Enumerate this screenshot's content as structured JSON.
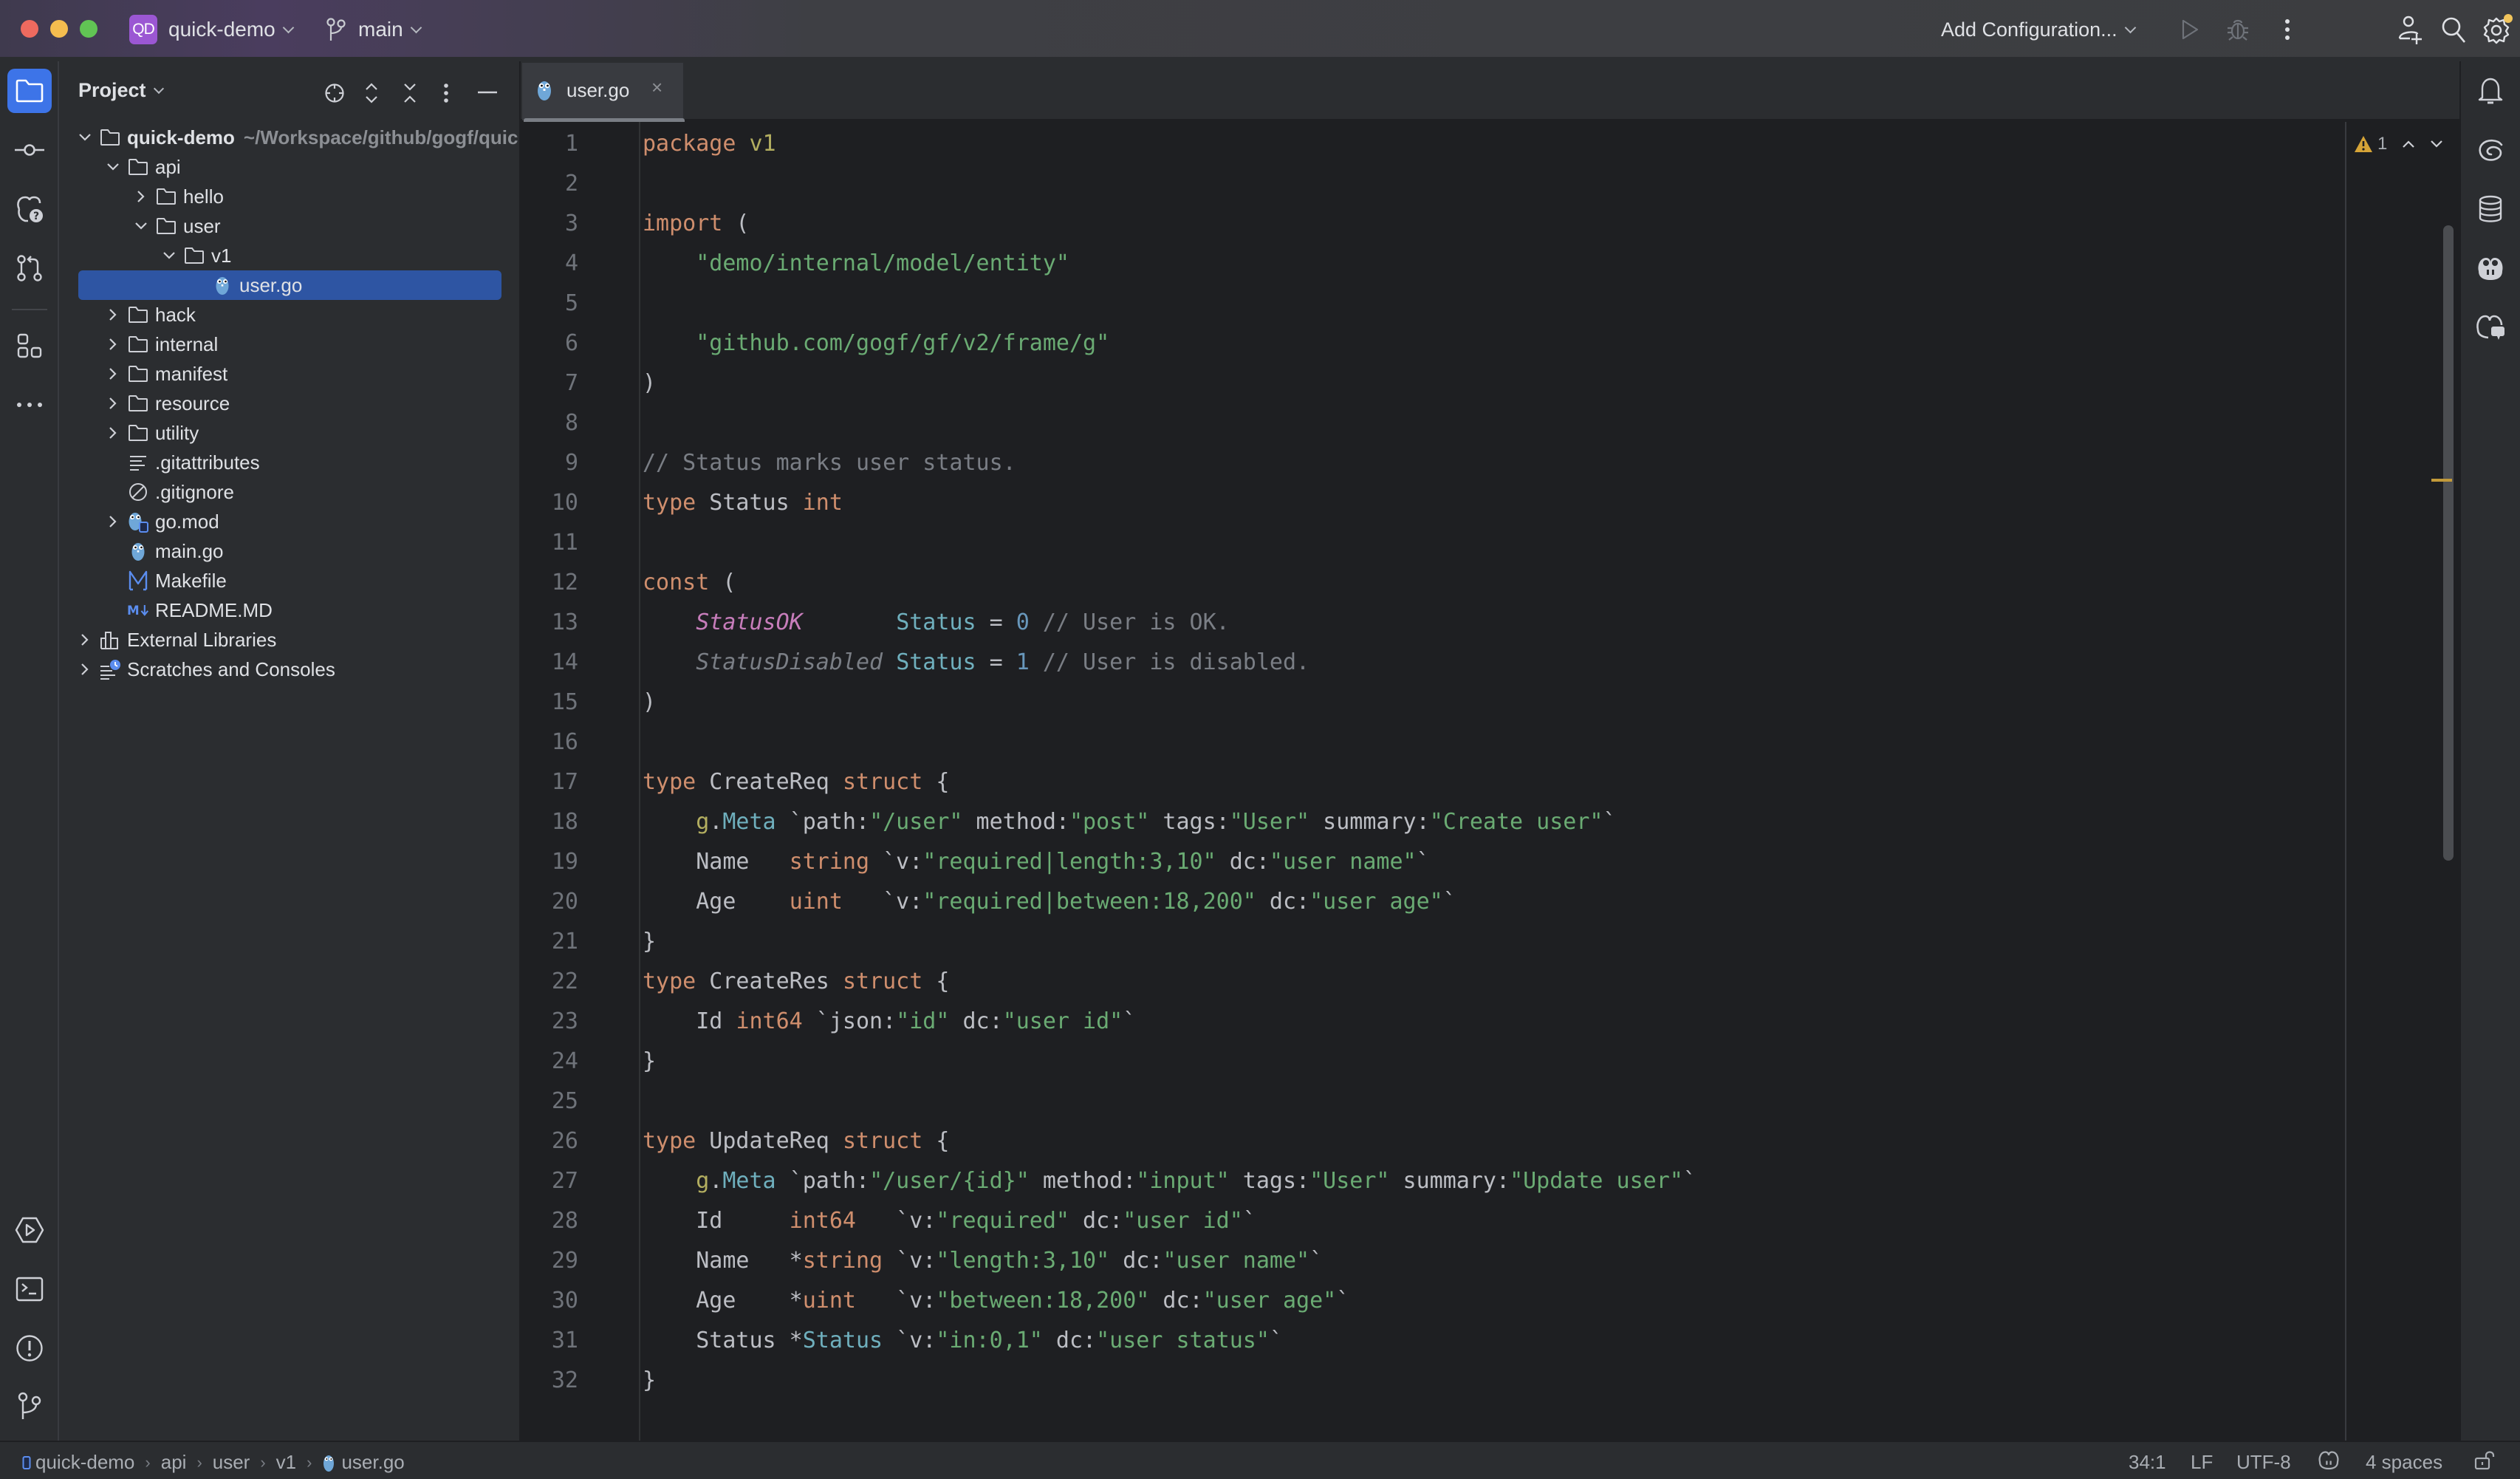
{
  "titlebar": {
    "project_badge": "QD",
    "project_name": "quick-demo",
    "branch": "main",
    "run_config": "Add Configuration...",
    "icons": [
      "run-icon",
      "debug-icon",
      "more-vertical-icon",
      "add-user-icon",
      "search-icon",
      "settings-icon"
    ]
  },
  "left_strip": {
    "top_tools": [
      "project",
      "commit",
      "copilot-help",
      "pull-requests",
      "structure",
      "more"
    ],
    "bottom_tools": [
      "services",
      "terminal",
      "problems",
      "git"
    ]
  },
  "project_panel": {
    "title": "Project",
    "tree": [
      {
        "label": "quick-demo",
        "path": "~/Workspace/github/gogf/quick-demo",
        "type": "folder",
        "depth": 0,
        "expanded": true,
        "bold": true
      },
      {
        "label": "api",
        "type": "folder",
        "depth": 1,
        "expanded": true
      },
      {
        "label": "hello",
        "type": "folder",
        "depth": 2,
        "expanded": false
      },
      {
        "label": "user",
        "type": "folder",
        "depth": 2,
        "expanded": true
      },
      {
        "label": "v1",
        "type": "folder",
        "depth": 3,
        "expanded": true
      },
      {
        "label": "user.go",
        "type": "go",
        "depth": 4,
        "selected": true
      },
      {
        "label": "hack",
        "type": "folder",
        "depth": 1,
        "expanded": false
      },
      {
        "label": "internal",
        "type": "folder",
        "depth": 1,
        "expanded": false
      },
      {
        "label": "manifest",
        "type": "folder",
        "depth": 1,
        "expanded": false
      },
      {
        "label": "resource",
        "type": "folder",
        "depth": 1,
        "expanded": false
      },
      {
        "label": "utility",
        "type": "folder",
        "depth": 1,
        "expanded": false
      },
      {
        "label": ".gitattributes",
        "type": "text",
        "depth": 1
      },
      {
        "label": ".gitignore",
        "type": "ignore",
        "depth": 1
      },
      {
        "label": "go.mod",
        "type": "gomod",
        "depth": 1,
        "expanded": false
      },
      {
        "label": "main.go",
        "type": "go",
        "depth": 1
      },
      {
        "label": "Makefile",
        "type": "makefile",
        "depth": 1
      },
      {
        "label": "README.MD",
        "type": "markdown",
        "depth": 1
      },
      {
        "label": "External Libraries",
        "type": "library",
        "depth": 0,
        "expanded": false
      },
      {
        "label": "Scratches and Consoles",
        "type": "scratches",
        "depth": 0,
        "expanded": false
      }
    ]
  },
  "editor": {
    "tab": {
      "label": "user.go",
      "close": "×"
    },
    "warnings": "1",
    "lines": [
      [
        [
          "k",
          "package"
        ],
        [
          "t",
          " "
        ],
        [
          "pk",
          "v1"
        ]
      ],
      [],
      [
        [
          "k",
          "import"
        ],
        [
          "t",
          " ("
        ]
      ],
      [
        [
          "t",
          "    "
        ],
        [
          "s",
          "\"demo/internal/model/entity\""
        ]
      ],
      [],
      [
        [
          "t",
          "    "
        ],
        [
          "s",
          "\"github.com/gogf/gf/v2/frame/g\""
        ]
      ],
      [
        [
          "t",
          ")"
        ]
      ],
      [],
      [
        [
          "c",
          "// Status marks user status."
        ]
      ],
      [
        [
          "k",
          "type"
        ],
        [
          "t",
          " Status "
        ],
        [
          "k",
          "int"
        ]
      ],
      [],
      [
        [
          "k",
          "const"
        ],
        [
          "t",
          " ("
        ]
      ],
      [
        [
          "t",
          "    "
        ],
        [
          "cv",
          "StatusOK"
        ],
        [
          "t",
          "       "
        ],
        [
          "ty",
          "Status"
        ],
        [
          "t",
          " = "
        ],
        [
          "n2",
          "0"
        ],
        [
          "t",
          " "
        ],
        [
          "c",
          "// User is OK."
        ]
      ],
      [
        [
          "t",
          "    "
        ],
        [
          "cvu",
          "StatusDisabled"
        ],
        [
          "t",
          " "
        ],
        [
          "ty",
          "Status"
        ],
        [
          "t",
          " = "
        ],
        [
          "n2",
          "1"
        ],
        [
          "t",
          " "
        ],
        [
          "c",
          "// User is disabled."
        ]
      ],
      [
        [
          "t",
          ")"
        ]
      ],
      [],
      [
        [
          "k",
          "type"
        ],
        [
          "t",
          " CreateReq "
        ],
        [
          "k",
          "struct"
        ],
        [
          "t",
          " {"
        ]
      ],
      [
        [
          "t",
          "    "
        ],
        [
          "gm",
          "g"
        ],
        [
          "t",
          "."
        ],
        [
          "ty",
          "Meta"
        ],
        [
          "t",
          " `path:"
        ],
        [
          "s",
          "\"/user\""
        ],
        [
          "t",
          " method:"
        ],
        [
          "s",
          "\"post\""
        ],
        [
          "t",
          " tags:"
        ],
        [
          "s",
          "\"User\""
        ],
        [
          "t",
          " summary:"
        ],
        [
          "s",
          "\"Create user\""
        ],
        [
          "t",
          "`"
        ]
      ],
      [
        [
          "t",
          "    Name   "
        ],
        [
          "k",
          "string"
        ],
        [
          "t",
          " `v:"
        ],
        [
          "s",
          "\"required|length:3,10\""
        ],
        [
          "t",
          " dc:"
        ],
        [
          "s",
          "\"user name\""
        ],
        [
          "t",
          "`"
        ]
      ],
      [
        [
          "t",
          "    Age    "
        ],
        [
          "k",
          "uint"
        ],
        [
          "t",
          "   `v:"
        ],
        [
          "s",
          "\"required|between:18,200\""
        ],
        [
          "t",
          " dc:"
        ],
        [
          "s",
          "\"user age\""
        ],
        [
          "t",
          "`"
        ]
      ],
      [
        [
          "t",
          "}"
        ]
      ],
      [
        [
          "k",
          "type"
        ],
        [
          "t",
          " CreateRes "
        ],
        [
          "k",
          "struct"
        ],
        [
          "t",
          " {"
        ]
      ],
      [
        [
          "t",
          "    Id "
        ],
        [
          "k",
          "int64"
        ],
        [
          "t",
          " `json:"
        ],
        [
          "s",
          "\"id\""
        ],
        [
          "t",
          " dc:"
        ],
        [
          "s",
          "\"user id\""
        ],
        [
          "t",
          "`"
        ]
      ],
      [
        [
          "t",
          "}"
        ]
      ],
      [],
      [
        [
          "k",
          "type"
        ],
        [
          "t",
          " UpdateReq "
        ],
        [
          "k",
          "struct"
        ],
        [
          "t",
          " {"
        ]
      ],
      [
        [
          "t",
          "    "
        ],
        [
          "gm",
          "g"
        ],
        [
          "t",
          "."
        ],
        [
          "ty",
          "Meta"
        ],
        [
          "t",
          " `path:"
        ],
        [
          "s",
          "\"/user/{id}\""
        ],
        [
          "t",
          " method:"
        ],
        [
          "s",
          "\"input\""
        ],
        [
          "t",
          " tags:"
        ],
        [
          "s",
          "\"User\""
        ],
        [
          "t",
          " summary:"
        ],
        [
          "s",
          "\"Update user\""
        ],
        [
          "t",
          "`"
        ]
      ],
      [
        [
          "t",
          "    Id     "
        ],
        [
          "k",
          "int64"
        ],
        [
          "t",
          "   `v:"
        ],
        [
          "s",
          "\"required\""
        ],
        [
          "t",
          " dc:"
        ],
        [
          "s",
          "\"user id\""
        ],
        [
          "t",
          "`"
        ]
      ],
      [
        [
          "t",
          "    Name   *"
        ],
        [
          "k",
          "string"
        ],
        [
          "t",
          " `v:"
        ],
        [
          "s",
          "\"length:3,10\""
        ],
        [
          "t",
          " dc:"
        ],
        [
          "s",
          "\"user name\""
        ],
        [
          "t",
          "`"
        ]
      ],
      [
        [
          "t",
          "    Age    *"
        ],
        [
          "k",
          "uint"
        ],
        [
          "t",
          "   `v:"
        ],
        [
          "s",
          "\"between:18,200\""
        ],
        [
          "t",
          " dc:"
        ],
        [
          "s",
          "\"user age\""
        ],
        [
          "t",
          "`"
        ]
      ],
      [
        [
          "t",
          "    Status *"
        ],
        [
          "ty",
          "Status"
        ],
        [
          "t",
          " `v:"
        ],
        [
          "s",
          "\"in:0,1\""
        ],
        [
          "t",
          " dc:"
        ],
        [
          "s",
          "\"user status\""
        ],
        [
          "t",
          "`"
        ]
      ],
      [
        [
          "t",
          "}"
        ]
      ]
    ]
  },
  "right_strip": {
    "tools": [
      "notifications",
      "ai-assistant",
      "database",
      "copilot",
      "copilot-chat"
    ]
  },
  "statusbar": {
    "breadcrumb": [
      "quick-demo",
      "api",
      "user",
      "v1",
      "user.go"
    ],
    "position": "34:1",
    "line_ending": "LF",
    "encoding": "UTF-8",
    "indent": "4 spaces"
  },
  "colors": {
    "accent": "#3d74e8",
    "selection": "#2e55a3",
    "keyword": "#cf8e6d",
    "string": "#6aab73",
    "comment": "#7a7e85",
    "warning": "#c29a3a",
    "project_badge": "#9b57d3"
  }
}
